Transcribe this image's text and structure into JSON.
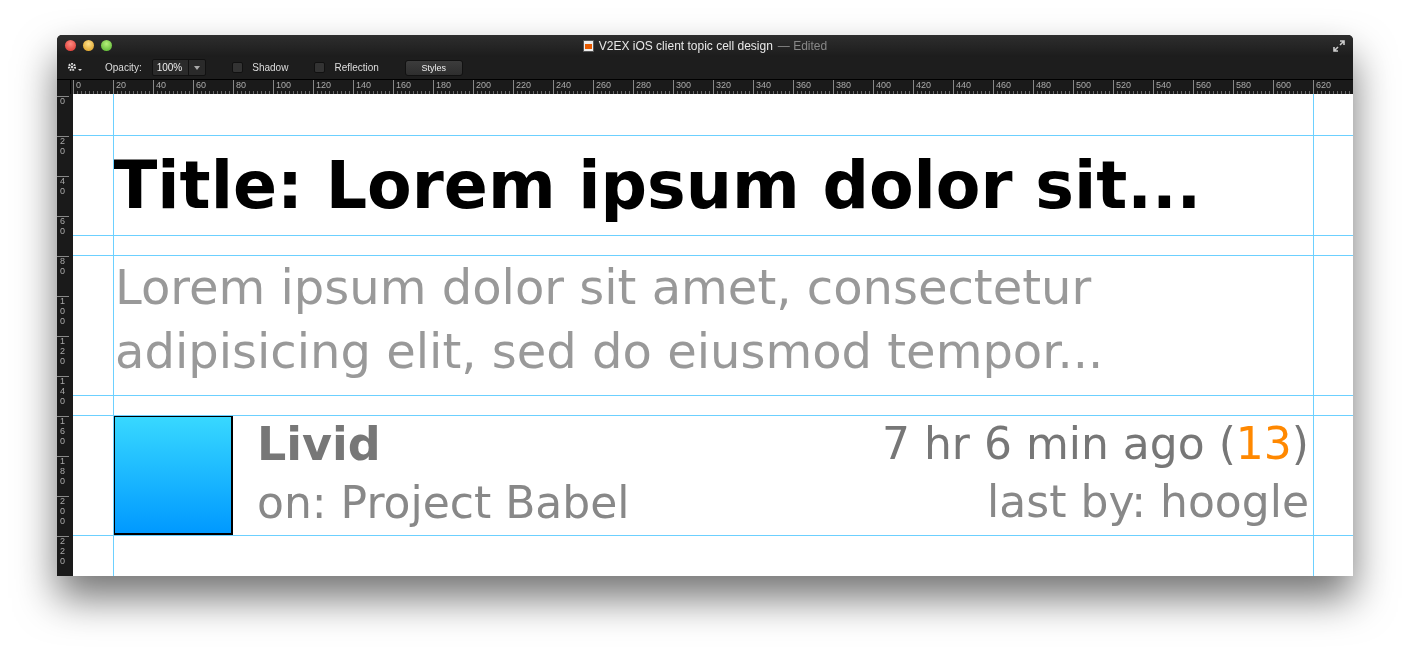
{
  "window": {
    "title": "V2EX iOS client topic cell design",
    "title_status": "— Edited"
  },
  "toolbar": {
    "opacity_label": "Opacity:",
    "opacity_value": "100%",
    "checkboxes": [
      {
        "label": "Shadow",
        "checked": false
      },
      {
        "label": "Reflection",
        "checked": false
      }
    ],
    "styles_button": "Styles"
  },
  "rulers": {
    "horizontal": [
      "0",
      "20",
      "40",
      "60",
      "80",
      "100",
      "120",
      "140",
      "160",
      "180",
      "200",
      "220",
      "240",
      "260",
      "280",
      "300",
      "320",
      "340",
      "360",
      "380",
      "400",
      "420",
      "440",
      "460",
      "480",
      "500",
      "520",
      "540",
      "560",
      "580",
      "600",
      "620"
    ],
    "vertical": [
      "0",
      "20",
      "40",
      "60",
      "80",
      "100",
      "120",
      "140",
      "160",
      "180",
      "200",
      "220"
    ]
  },
  "cell": {
    "title": "Title: Lorem ipsum dolor sit...",
    "summary": "Lorem ipsum dolor sit amet, consectetur adipisicing elit, sed do eiusmod tempor...",
    "author": "Livid",
    "node": "on: Project Babel",
    "time": "7 hr 6 min ago (",
    "replies": "13",
    "time_close": ")",
    "last_by": "last by: hoogle"
  }
}
